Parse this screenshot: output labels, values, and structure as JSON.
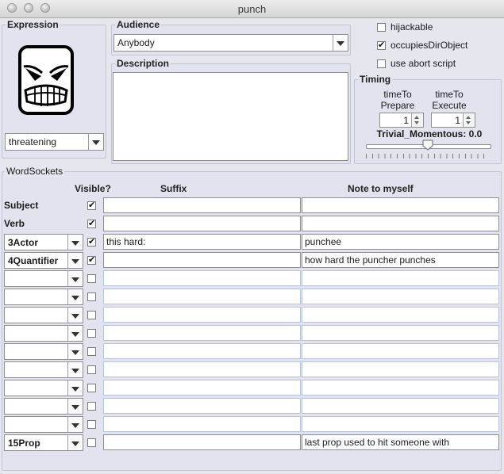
{
  "window": {
    "title": "punch"
  },
  "expression": {
    "legend": "Expression",
    "face_icon": "angry-face-icon",
    "selected": "threatening"
  },
  "audience": {
    "legend": "Audience",
    "selected": "Anybody"
  },
  "description": {
    "legend": "Description",
    "value": ""
  },
  "options": [
    {
      "label": "hijackable",
      "checked": false
    },
    {
      "label": "occupiesDirObject",
      "checked": true
    },
    {
      "label": "use abort script",
      "checked": false
    }
  ],
  "timing": {
    "legend": "Timing",
    "time_to_prepare_label_1": "timeTo",
    "time_to_prepare_label_2": "Prepare",
    "time_to_prepare_value": "1",
    "time_to_execute_label_1": "timeTo",
    "time_to_execute_label_2": "Execute",
    "time_to_execute_value": "1",
    "trivial_momentous_label": "Trivial_Momentous: 0.0",
    "trivial_momentous_value": 0.0
  },
  "word_sockets": {
    "legend": "WordSockets",
    "columns": {
      "visible": "Visible?",
      "suffix": "Suffix",
      "note": "Note to myself"
    },
    "rows": [
      {
        "label": "Subject",
        "is_combo": false,
        "visible": true,
        "suffix": "",
        "note": ""
      },
      {
        "label": "Verb",
        "is_combo": false,
        "visible": true,
        "suffix": "",
        "note": ""
      },
      {
        "label": "3Actor",
        "is_combo": true,
        "visible": true,
        "suffix": "this hard:",
        "note": "punchee"
      },
      {
        "label": "4Quantifier",
        "is_combo": true,
        "visible": true,
        "suffix": "",
        "note": "how hard the puncher punches"
      },
      {
        "label": "",
        "is_combo": true,
        "visible": false,
        "suffix": "",
        "note": ""
      },
      {
        "label": "",
        "is_combo": true,
        "visible": false,
        "suffix": "",
        "note": ""
      },
      {
        "label": "",
        "is_combo": true,
        "visible": false,
        "suffix": "",
        "note": ""
      },
      {
        "label": "",
        "is_combo": true,
        "visible": false,
        "suffix": "",
        "note": ""
      },
      {
        "label": "",
        "is_combo": true,
        "visible": false,
        "suffix": "",
        "note": ""
      },
      {
        "label": "",
        "is_combo": true,
        "visible": false,
        "suffix": "",
        "note": ""
      },
      {
        "label": "",
        "is_combo": true,
        "visible": false,
        "suffix": "",
        "note": ""
      },
      {
        "label": "",
        "is_combo": true,
        "visible": false,
        "suffix": "",
        "note": ""
      },
      {
        "label": "",
        "is_combo": true,
        "visible": false,
        "suffix": "",
        "note": ""
      },
      {
        "label": "15Prop",
        "is_combo": true,
        "visible": false,
        "suffix": "",
        "note": "last prop used to hit someone with"
      }
    ]
  }
}
